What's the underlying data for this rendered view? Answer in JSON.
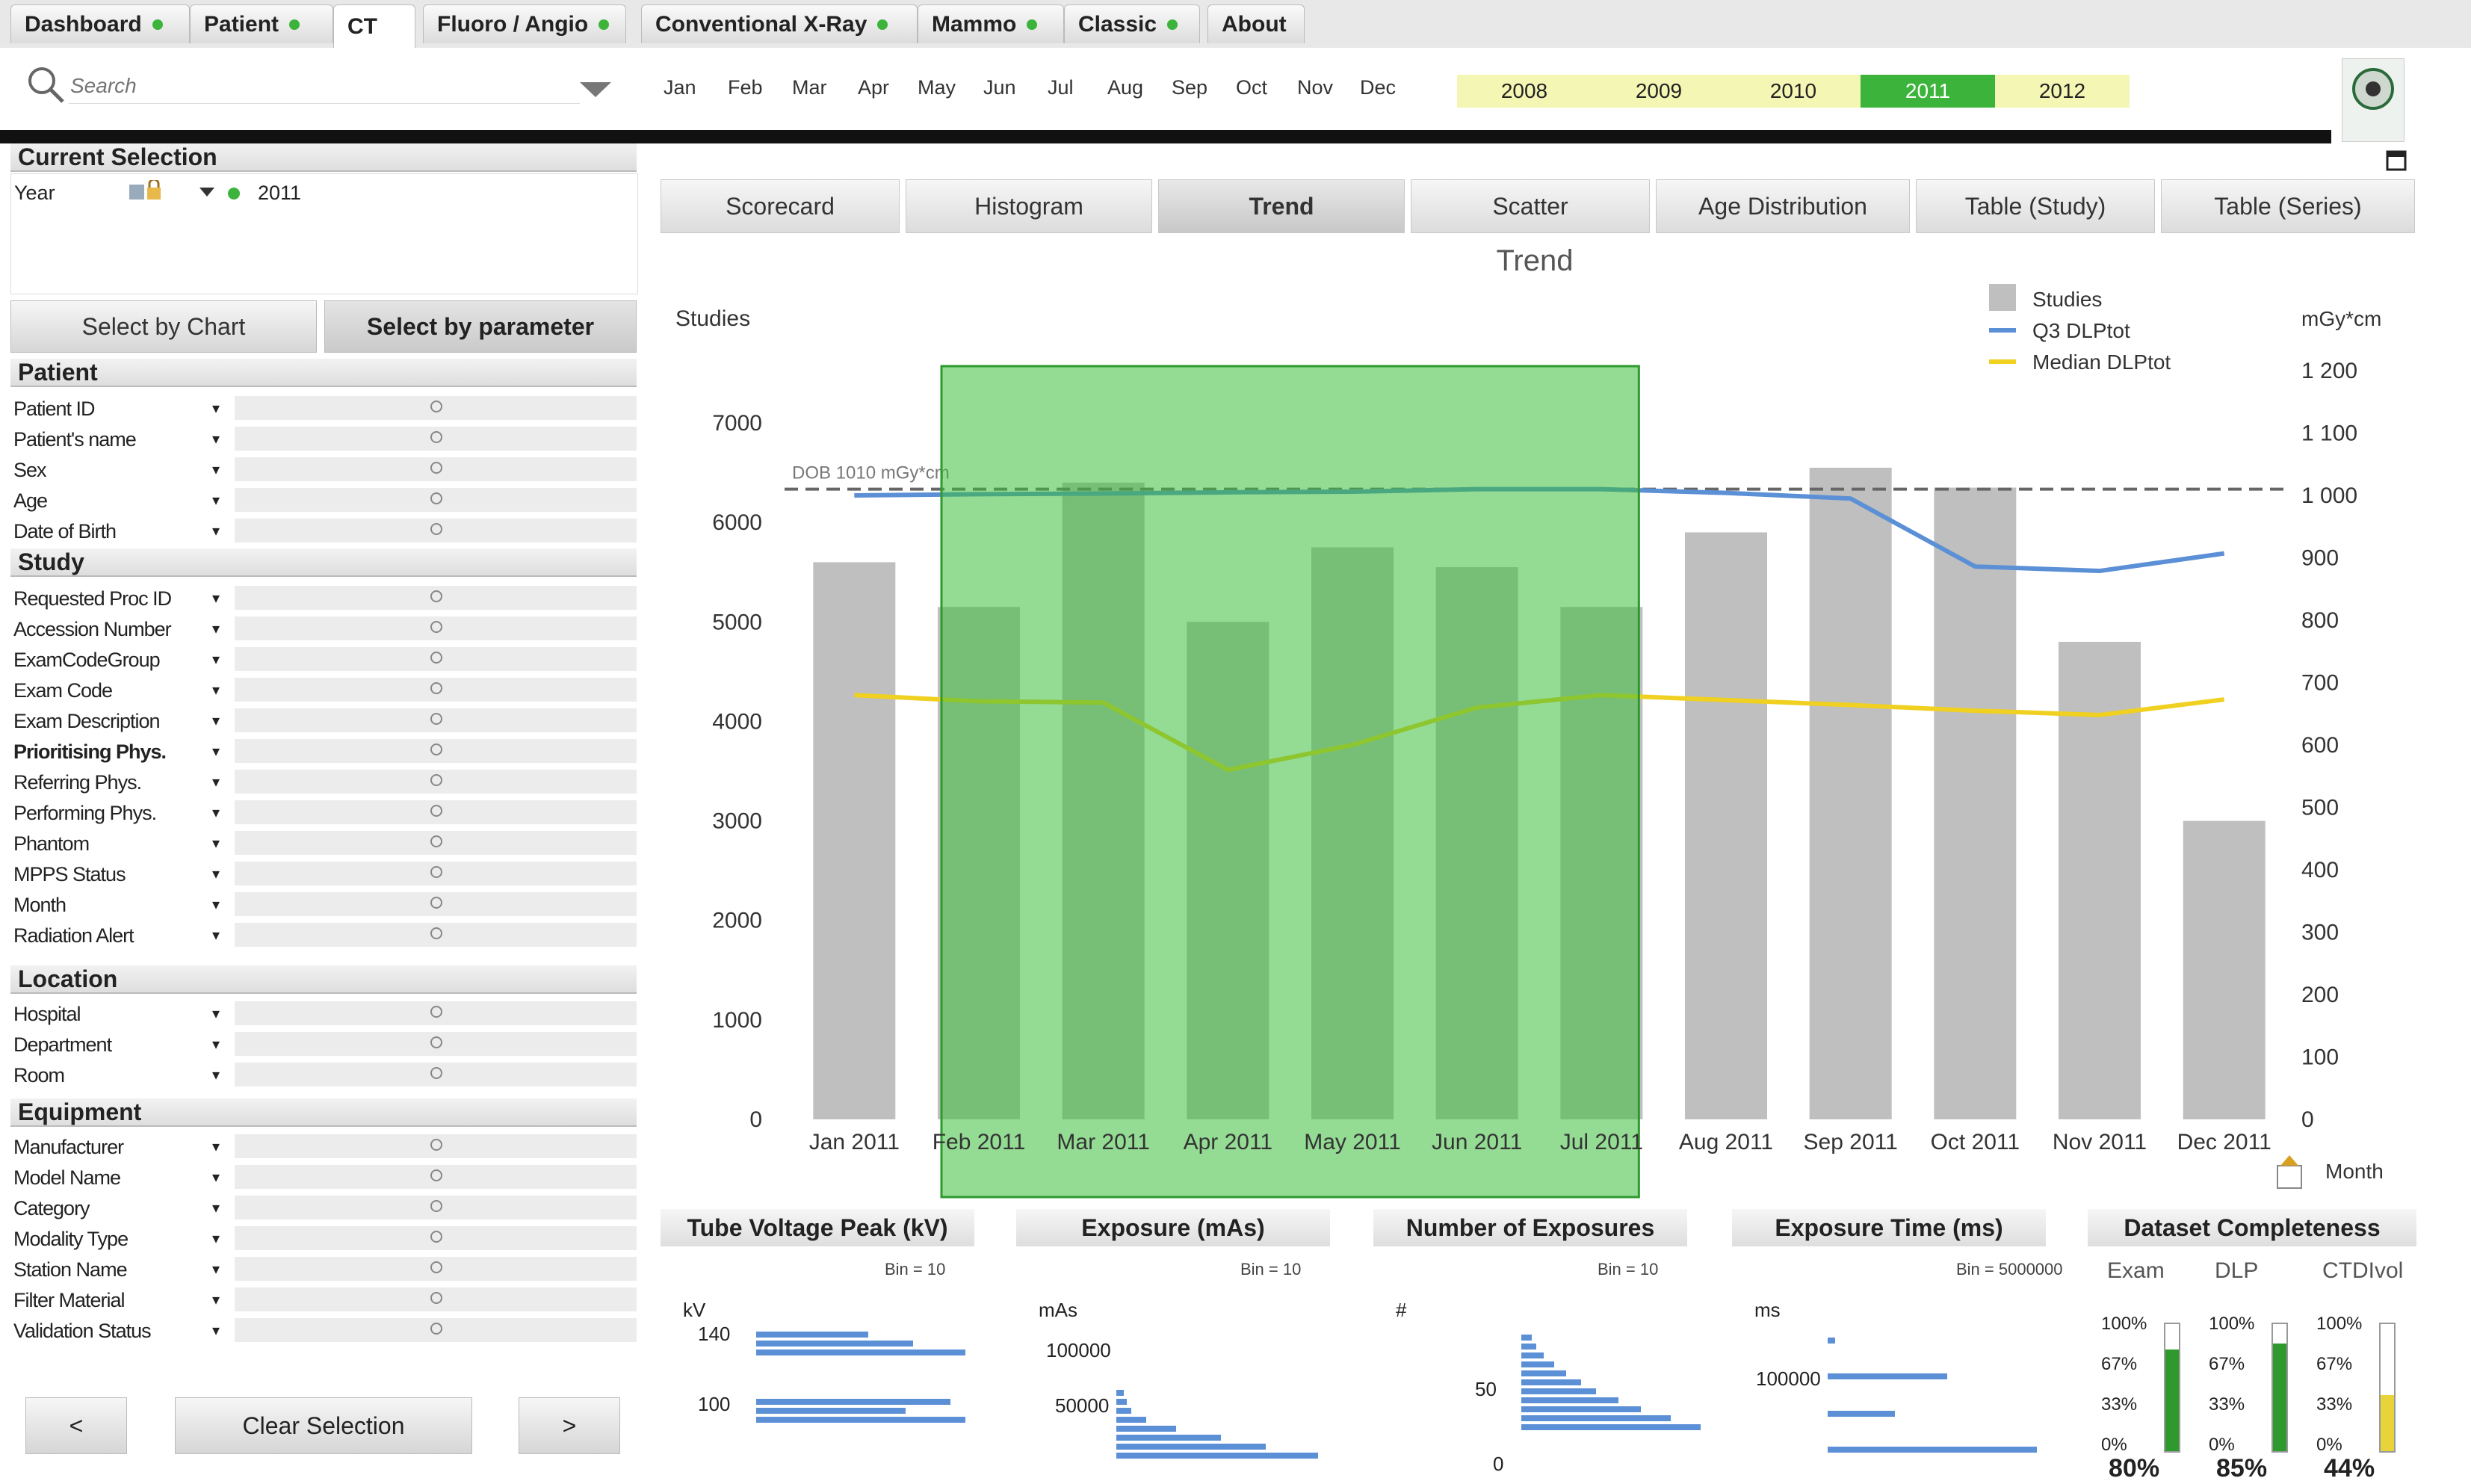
{
  "top_tabs": [
    {
      "label": "Dashboard",
      "dot": true
    },
    {
      "label": "Patient",
      "dot": true
    },
    {
      "label": "CT",
      "dot": false
    },
    {
      "label": "Fluoro / Angio",
      "dot": true
    },
    {
      "label": "Conventional X-Ray",
      "dot": true
    },
    {
      "label": "Mammo",
      "dot": true
    },
    {
      "label": "Classic",
      "dot": true
    },
    {
      "label": "About",
      "dot": false
    }
  ],
  "search": {
    "placeholder": "Search"
  },
  "months": [
    "Jan",
    "Feb",
    "Mar",
    "Apr",
    "May",
    "Jun",
    "Jul",
    "Aug",
    "Sep",
    "Oct",
    "Nov",
    "Dec"
  ],
  "years": [
    "2008",
    "2009",
    "2010",
    "2011",
    "2012"
  ],
  "selected_year": "2011",
  "current_selection": {
    "title": "Current Selection",
    "field": "Year",
    "value": "2011"
  },
  "select_tabs": {
    "chart": "Select by Chart",
    "parameter": "Select by parameter"
  },
  "sections": {
    "patient": {
      "title": "Patient",
      "items": [
        "Patient ID",
        "Patient's name",
        "Sex",
        "Age",
        "Date of Birth"
      ]
    },
    "study": {
      "title": "Study",
      "items": [
        "Requested Proc ID",
        "Accession Number",
        "ExamCodeGroup",
        "Exam Code",
        "Exam Description",
        "Prioritising Phys.",
        "Referring Phys.",
        "Performing Phys.",
        "Phantom",
        "MPPS Status",
        "Month",
        "Radiation Alert"
      ]
    },
    "location": {
      "title": "Location",
      "items": [
        "Hospital",
        "Department",
        "Room"
      ]
    },
    "equipment": {
      "title": "Equipment",
      "items": [
        "Manufacturer",
        "Model Name",
        "Category",
        "Modality Type",
        "Station Name",
        "Filter Material",
        "Validation Status"
      ]
    }
  },
  "nav": {
    "prev": "<",
    "clear": "Clear Selection",
    "next": ">"
  },
  "main_tabs": [
    "Scorecard",
    "Histogram",
    "Trend",
    "Scatter",
    "Age Distribution",
    "Table (Study)",
    "Table (Series)"
  ],
  "active_main_tab": "Trend",
  "month_label": "Month",
  "chart_data": {
    "type": "bar",
    "title": "Trend",
    "ylabel": "Studies",
    "y2label": "mGy*cm",
    "ylim": [
      0,
      7000
    ],
    "y2lim": [
      0,
      1200
    ],
    "yticks": [
      "0",
      "1000",
      "2000",
      "3000",
      "4000",
      "5000",
      "6000",
      "7000"
    ],
    "y2ticks": [
      "0",
      "100",
      "200",
      "300",
      "400",
      "500",
      "600",
      "700",
      "800",
      "900",
      "1 000",
      "1 100",
      "1 200"
    ],
    "categories": [
      "Jan 2011",
      "Feb 2011",
      "Mar 2011",
      "Apr 2011",
      "May 2011",
      "Jun 2011",
      "Jul 2011",
      "Aug 2011",
      "Sep 2011",
      "Oct 2011",
      "Nov 2011",
      "Dec 2011"
    ],
    "series": [
      {
        "name": "Studies",
        "type": "bar",
        "axis": "left",
        "color": "#bfbfbf",
        "values": [
          5600,
          5150,
          6400,
          5000,
          5750,
          5550,
          5150,
          5900,
          6550,
          6350,
          4800,
          3000
        ]
      },
      {
        "name": "Q3 DLPtot",
        "type": "line",
        "axis": "right",
        "color": "#5b8fd6",
        "values": [
          1000,
          1002,
          1003,
          1005,
          1006,
          1010,
          1010,
          1004,
          995,
          886,
          879,
          907
        ]
      },
      {
        "name": "Median DLPtot",
        "type": "line",
        "axis": "right",
        "color": "#f0d020",
        "values": [
          680,
          670,
          668,
          560,
          600,
          660,
          680,
          672,
          664,
          655,
          648,
          673
        ]
      }
    ],
    "reference_line": {
      "label": "DOB 1010 mGy*cm",
      "value": 1010
    },
    "highlight": {
      "from": "Feb 2011",
      "to": "Jul 2011"
    },
    "legend_position": "top-right"
  },
  "bottom_panels": [
    {
      "title": "Tube Voltage Peak (kV)",
      "bin": "Bin = 10",
      "unit": "kV",
      "ticks": [
        "140",
        "100"
      ]
    },
    {
      "title": "Exposure (mAs)",
      "bin": "Bin = 10",
      "unit": "mAs",
      "ticks": [
        "100000",
        "50000"
      ]
    },
    {
      "title": "Number of Exposures",
      "bin": "Bin = 10",
      "unit": "#",
      "ticks": [
        "50",
        "0"
      ]
    },
    {
      "title": "Exposure Time (ms)",
      "bin": "Bin = 5000000",
      "unit": "ms",
      "ticks": [
        "100000"
      ]
    },
    {
      "title": "Dataset Completeness",
      "cols": [
        "Exam",
        "DLP",
        "CTDIvol"
      ],
      "ticks": [
        "100%",
        "67%",
        "33%",
        "0%"
      ],
      "values": [
        "80%",
        "85%",
        "44%"
      ],
      "fills": [
        0.8,
        0.85,
        0.44
      ]
    }
  ]
}
